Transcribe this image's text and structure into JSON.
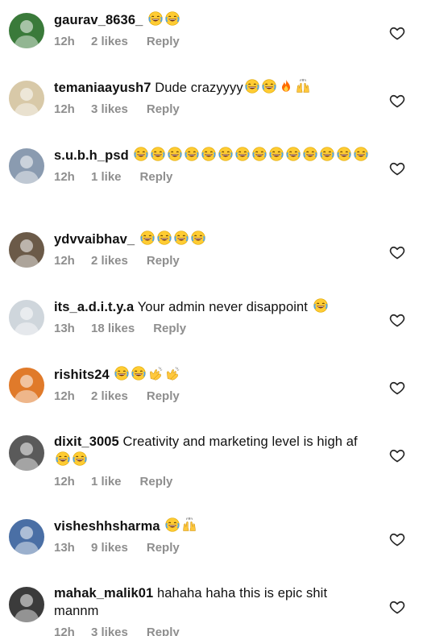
{
  "comments": [
    {
      "username": "gaurav_8636_",
      "text": "",
      "emojis": [
        "laugh",
        "laugh"
      ],
      "time": "12h",
      "likes": "2 likes",
      "reply": "Reply",
      "avatar_color": "#3a7a3a"
    },
    {
      "username": "temaniaayush7",
      "text": "Dude crazyyyy",
      "emojis": [
        "laugh",
        "laugh",
        "fire",
        "raised-hands"
      ],
      "time": "12h",
      "likes": "3 likes",
      "reply": "Reply",
      "avatar_color": "#d8c9a8"
    },
    {
      "username": "s.u.b.h_psd",
      "text": "",
      "emojis": [
        "laugh",
        "laugh",
        "laugh",
        "laugh",
        "laugh",
        "laugh",
        "laugh",
        "laugh",
        "laugh",
        "laugh",
        "laugh",
        "laugh",
        "laugh",
        "laugh"
      ],
      "time": "12h",
      "likes": "1 like",
      "reply": "Reply",
      "avatar_color": "#8a9bb0"
    },
    {
      "username": "ydvvaibhav_",
      "text": "",
      "emojis": [
        "laugh",
        "laugh",
        "laugh",
        "laugh"
      ],
      "time": "12h",
      "likes": "2 likes",
      "reply": "Reply",
      "avatar_color": "#6b5a48"
    },
    {
      "username": "its_a.d.i.t.y.a",
      "text": "Your admin never disappoint",
      "emojis": [
        "laugh"
      ],
      "time": "13h",
      "likes": "18 likes",
      "reply": "Reply",
      "avatar_color": "#cfd6dc"
    },
    {
      "username": "rishits24",
      "text": "",
      "emojis": [
        "laugh",
        "laugh",
        "clap",
        "clap"
      ],
      "time": "12h",
      "likes": "2 likes",
      "reply": "Reply",
      "avatar_color": "#e07a2a"
    },
    {
      "username": "dixit_3005",
      "text": "Creativity and marketing level is high af",
      "emojis": [
        "laugh",
        "laugh"
      ],
      "time": "12h",
      "likes": "1 like",
      "reply": "Reply",
      "avatar_color": "#5a5a5a"
    },
    {
      "username": "visheshhsharma",
      "text": "",
      "emojis": [
        "laugh",
        "raised-hands"
      ],
      "time": "13h",
      "likes": "9 likes",
      "reply": "Reply",
      "avatar_color": "#4a6fa5"
    },
    {
      "username": "mahak_malik01",
      "text": "hahaha haha this is epic shit mannm",
      "emojis": [],
      "time": "12h",
      "likes": "3 likes",
      "reply": "Reply",
      "avatar_color": "#3b3b3b"
    }
  ]
}
